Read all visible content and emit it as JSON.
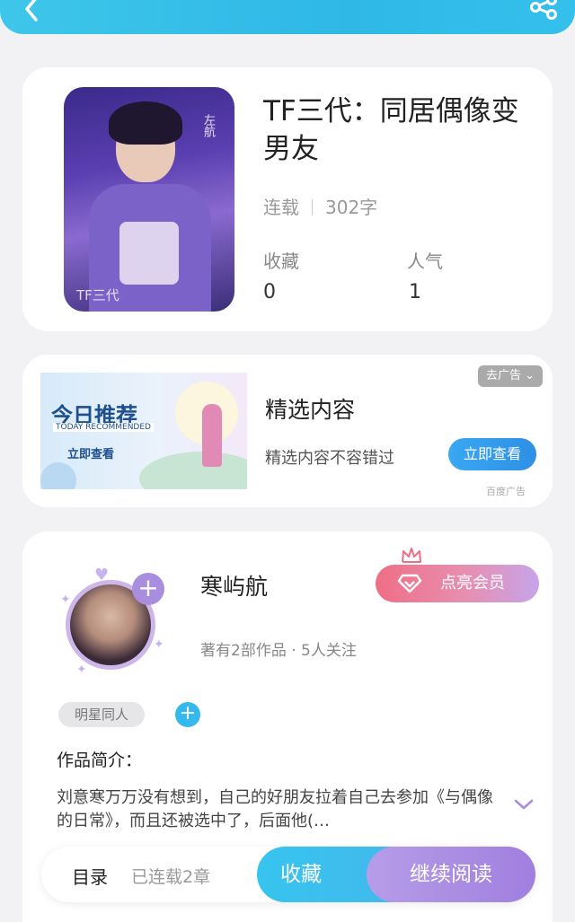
{
  "header": {
    "back_icon": "chevron-left-icon",
    "share_icon": "share-icon",
    "color": "#35bfeb"
  },
  "book": {
    "title": "TF三代：同居偶像变男友",
    "status": "连载",
    "word_count": "302字",
    "favorites_label": "收藏",
    "favorites_value": "0",
    "popularity_label": "人气",
    "popularity_value": "1",
    "cover_side_text": "左航",
    "cover_text": "TF三代"
  },
  "ad": {
    "banner_title": "今日推荐",
    "banner_subtitle": "TODAY RECOMMENDED",
    "banner_button": "立即查看",
    "title": "精选内容",
    "description": "精选内容不容错过",
    "close_label": "去广告",
    "cta_label": "立即查看",
    "source": "百度广告"
  },
  "author": {
    "name": "寒屿航",
    "stats": "著有2部作品 · 5人关注",
    "vip_label": "点亮会员",
    "tag": "明星同人",
    "intro_label": "作品简介：",
    "intro_text": "刘意寒万万没有想到，自己的好朋友拉着自己去参加《与偶像的日常》，而且还被选中了，后面他(…",
    "accent": "#a98ee0"
  },
  "bottom_bar": {
    "toc_label": "目录",
    "toc_status": "已连载2章",
    "favorite_label": "收藏",
    "read_label": "继续阅读"
  }
}
